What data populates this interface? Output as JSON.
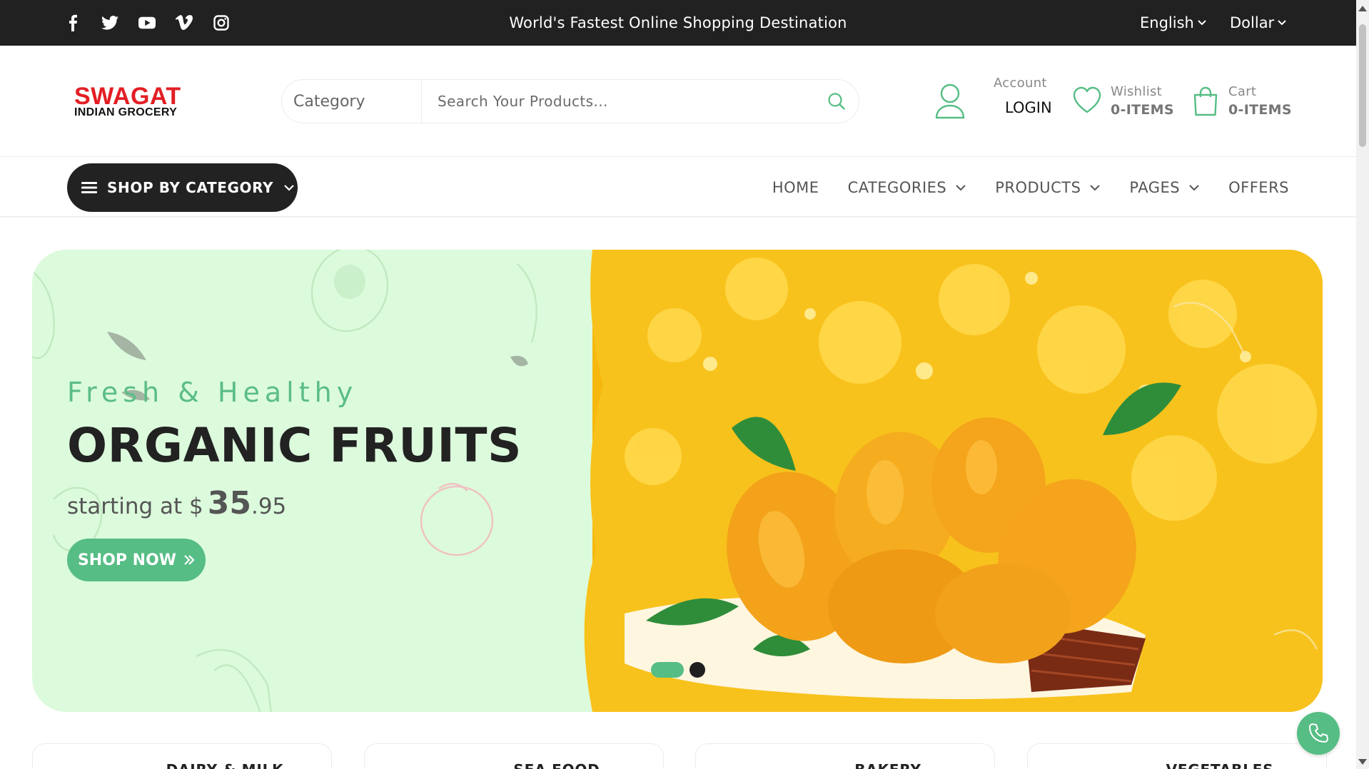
{
  "topbar": {
    "tagline": "World's Fastest Online Shopping Destination",
    "language": "English",
    "currency": "Dollar",
    "socials": [
      "facebook-icon",
      "twitter-icon",
      "youtube-icon",
      "vimeo-icon",
      "instagram-icon"
    ]
  },
  "header": {
    "logo_brand": "SWAGAT",
    "logo_sub": "INDIAN GROCERY",
    "search_category": "Category",
    "search_placeholder": "Search Your Products...",
    "account_label": "Account",
    "account_value": "LOGIN",
    "wishlist_label": "Wishlist",
    "wishlist_value": "0-ITEMS",
    "cart_label": "Cart",
    "cart_value": "0-ITEMS"
  },
  "nav": {
    "shop_by_category": "SHOP BY CATEGORY",
    "items": [
      {
        "label": "HOME",
        "dropdown": false
      },
      {
        "label": "CATEGORIES",
        "dropdown": true
      },
      {
        "label": "PRODUCTS",
        "dropdown": true
      },
      {
        "label": "PAGES",
        "dropdown": true
      },
      {
        "label": "OFFERS",
        "dropdown": false
      }
    ]
  },
  "hero": {
    "eyebrow": "Fresh & Healthy",
    "title": "ORGANIC FRUITS",
    "price_prefix": "starting at $",
    "price_whole": "35",
    "price_fraction": ".95",
    "cta": "SHOP NOW",
    "slides_total": 2,
    "active_slide": 1
  },
  "categories": [
    {
      "name": "DAIRY & MILK"
    },
    {
      "name": "SEA FOOD"
    },
    {
      "name": "BAKERY"
    },
    {
      "name": "VEGETABLES"
    }
  ],
  "colors": {
    "accent_green": "#56bd84",
    "topbar_bg": "#212121",
    "hero_bg": "#dcfbdc",
    "brand_red": "#e31e24"
  }
}
